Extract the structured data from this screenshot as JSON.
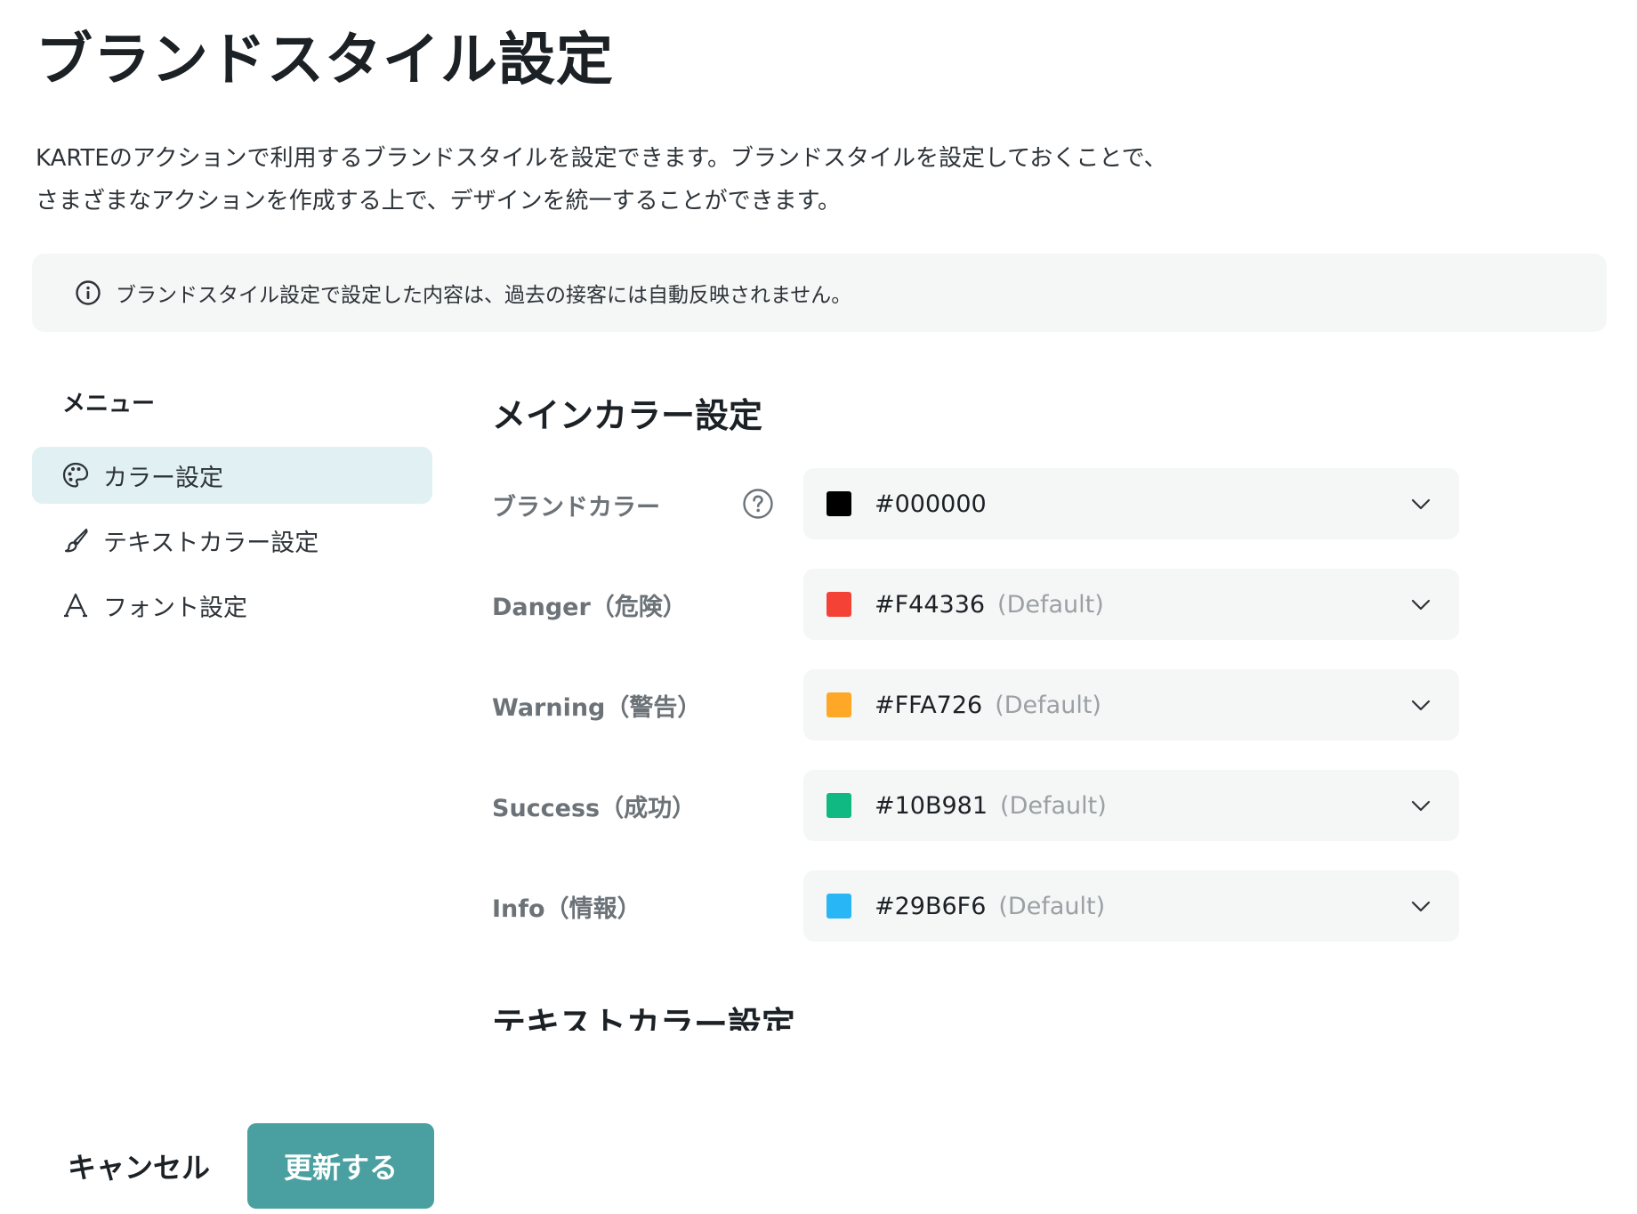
{
  "page": {
    "title": "ブランドスタイル設定",
    "description_line1": "KARTEのアクションで利用するブランドスタイルを設定できます。ブランドスタイルを設定しておくことで、",
    "description_line2": "さまざまなアクションを作成する上で、デザインを統一することができます。"
  },
  "notice": {
    "icon": "info-icon",
    "text": "ブランドスタイル設定で設定した内容は、過去の接客には自動反映されません。"
  },
  "menu": {
    "title": "メニュー",
    "items": [
      {
        "label": "カラー設定",
        "icon": "palette-icon",
        "active": true
      },
      {
        "label": "テキストカラー設定",
        "icon": "brush-icon",
        "active": false
      },
      {
        "label": "フォント設定",
        "icon": "font-icon",
        "active": false
      }
    ]
  },
  "main_color_section": {
    "title": "メインカラー設定",
    "rows": [
      {
        "label": "ブランドカラー",
        "value": "#000000",
        "default_tag": "",
        "swatch": "#000000",
        "has_help": true
      },
      {
        "label": "Danger（危険）",
        "value": "#F44336",
        "default_tag": "(Default)",
        "swatch": "#F44336",
        "has_help": false
      },
      {
        "label": "Warning（警告）",
        "value": "#FFA726",
        "default_tag": "(Default)",
        "swatch": "#FFA726",
        "has_help": false
      },
      {
        "label": "Success（成功）",
        "value": "#10B981",
        "default_tag": "(Default)",
        "swatch": "#10B981",
        "has_help": false
      },
      {
        "label": "Info（情報）",
        "value": "#29B6F6",
        "default_tag": "(Default)",
        "swatch": "#29B6F6",
        "has_help": false
      }
    ]
  },
  "text_color_section": {
    "title": "テキストカラー設定"
  },
  "footer": {
    "cancel_label": "キャンセル",
    "update_label": "更新する"
  },
  "colors": {
    "accent": "#4AA0A0",
    "active_menu_bg": "#E1F0F2"
  }
}
